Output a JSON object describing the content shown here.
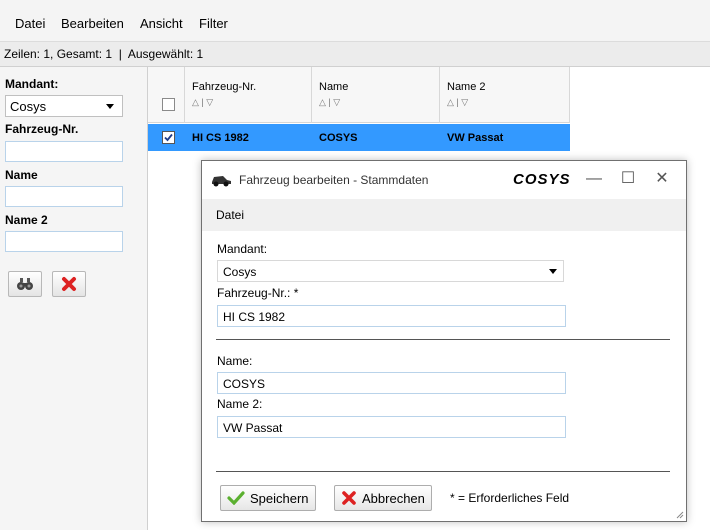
{
  "menu": [
    "Datei",
    "Bearbeiten",
    "Ansicht",
    "Filter"
  ],
  "status": "Zeilen: 1, Gesamt: 1  |  Ausgewählt: 1",
  "filter": {
    "mandant_label": "Mandant:",
    "mandant_value": "Cosys",
    "fahrzeug_label": "Fahrzeug-Nr.",
    "name_label": "Name",
    "name2_label": "Name 2"
  },
  "grid": {
    "columns": [
      "Fahrzeug-Nr.",
      "Name",
      "Name 2"
    ],
    "sort_glyph": "△ | ▽",
    "rows": [
      {
        "fahrzeug": "HI CS 1982",
        "name": "COSYS",
        "name2": "VW Passat",
        "checked": true
      }
    ]
  },
  "dialog": {
    "title": "Fahrzeug bearbeiten - Stammdaten",
    "logo": "COSYS",
    "menu": "Datei",
    "mandant_label": "Mandant:",
    "mandant_value": "Cosys",
    "fahrzeug_label": "Fahrzeug-Nr.: *",
    "fahrzeug_value": "HI CS 1982",
    "name_label": "Name:",
    "name_value": "COSYS",
    "name2_label": "Name 2:",
    "name2_value": "VW Passat",
    "save_label": "Speichern",
    "cancel_label": "Abbrechen",
    "required_note": "* = Erforderliches Feld"
  },
  "colors": {
    "selection": "#3399ff",
    "input_border": "#b9d3ea"
  }
}
